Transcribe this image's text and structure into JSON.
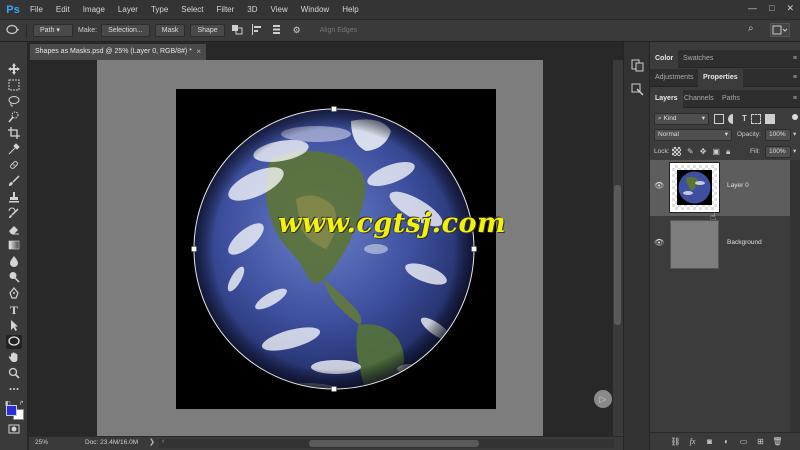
{
  "menubar": {
    "logo": "Ps",
    "items": [
      "File",
      "Edit",
      "Image",
      "Layer",
      "Type",
      "Select",
      "Filter",
      "3D",
      "View",
      "Window",
      "Help"
    ],
    "window_controls": [
      "—",
      "□",
      "✕"
    ]
  },
  "options": {
    "mode": "Path",
    "make_label": "Make:",
    "selection_btn": "Selection...",
    "mask_btn": "Mask",
    "shape_btn": "Shape",
    "align_edges": "Align Edges"
  },
  "document": {
    "tab_title": "Shapes as Masks.psd @ 25% (Layer 0, RGB/8#) *",
    "tab_close": "×"
  },
  "status": {
    "zoom": "25%",
    "doc_info": "Doc: 23.4M/16.0M"
  },
  "panels": {
    "top_tabs": [
      "Color",
      "Swatches"
    ],
    "mid_tabs": [
      "Adjustments",
      "Properties"
    ],
    "layer_tabs": [
      "Layers",
      "Channels",
      "Paths"
    ],
    "filter_kind": "Kind",
    "blend_mode": "Normal",
    "opacity_label": "Opacity:",
    "opacity_value": "100%",
    "lock_label": "Lock:",
    "fill_label": "Fill:",
    "fill_value": "100%",
    "layers": [
      {
        "name": "Layer 0",
        "visible": true,
        "selected": true
      },
      {
        "name": "Background",
        "visible": true,
        "selected": false
      }
    ]
  },
  "watermark": "www.cgtsj.com",
  "colors": {
    "foreground": "#2b2fd8",
    "background": "#ffffff",
    "selected_layer": "#5d5d5d"
  }
}
